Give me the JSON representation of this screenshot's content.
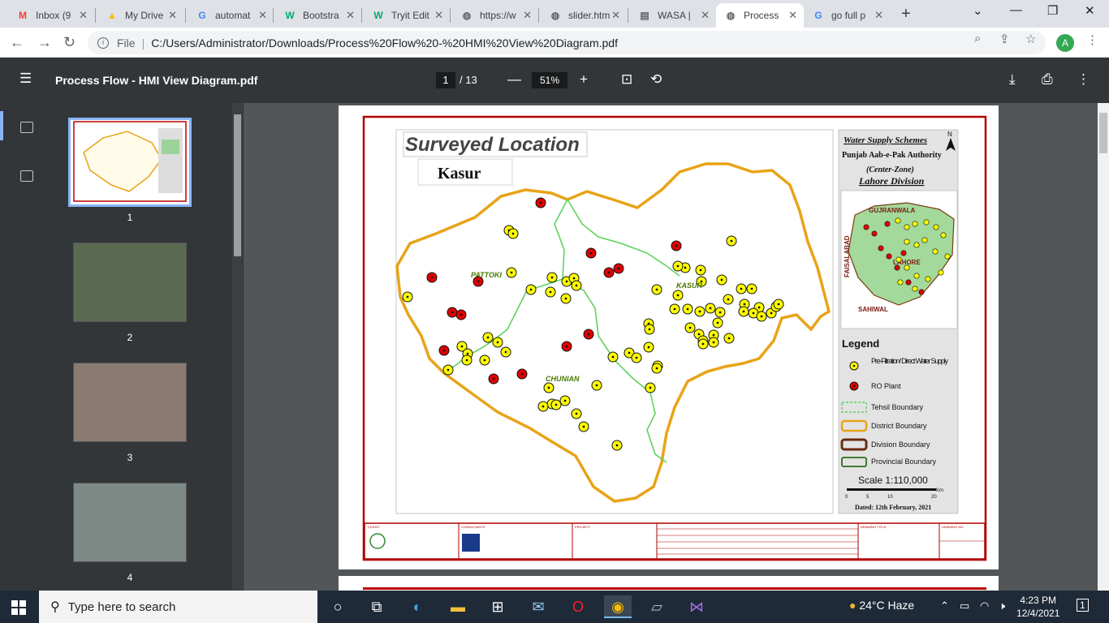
{
  "browser": {
    "tabs": [
      {
        "title": "Inbox (9",
        "icon": "gmail-icon",
        "glyph": "M",
        "color": "#ea4335"
      },
      {
        "title": "My Drive",
        "icon": "google-drive-icon",
        "glyph": "▲",
        "color": "#fbbc04"
      },
      {
        "title": "automat",
        "icon": "google-icon",
        "glyph": "G",
        "color": "#4285f4"
      },
      {
        "title": "Bootstra",
        "icon": "w3schools-icon",
        "glyph": "W",
        "color": "#04aa6d"
      },
      {
        "title": "Tryit Edit",
        "icon": "w3schools-icon",
        "glyph": "W",
        "color": "#04aa6d"
      },
      {
        "title": "https://w",
        "icon": "globe-icon",
        "glyph": "◍",
        "color": "#5f6368"
      },
      {
        "title": "slider.htm",
        "icon": "globe-icon",
        "glyph": "◍",
        "color": "#5f6368"
      },
      {
        "title": "WASA |",
        "icon": "document-icon",
        "glyph": "▤",
        "color": "#5f6368"
      },
      {
        "title": "Process",
        "icon": "globe-icon",
        "glyph": "◍",
        "color": "#5f6368",
        "active": true
      },
      {
        "title": "go full p",
        "icon": "google-icon",
        "glyph": "G",
        "color": "#4285f4"
      }
    ],
    "address": {
      "scheme_label": "File",
      "url": "C:/Users/Administrator/Downloads/Process%20Flow%20-%20HMI%20View%20Diagram.pdf"
    },
    "profile_initial": "A"
  },
  "pdf": {
    "title": "Process Flow - HMI View Diagram.pdf",
    "current_page": "1",
    "total_pages": "/ 13",
    "zoom": "51%",
    "thumbnails": [
      "1",
      "2",
      "3",
      "4"
    ]
  },
  "map": {
    "title": "Surveyed Location",
    "district": "Kasur",
    "towns": [
      "PATTOKI",
      "KASUR",
      "CHUNIAN"
    ],
    "header": {
      "line1": "Water Supply Schemes",
      "line2": "Punjab Aab-e-Pak Authority",
      "line3": "(Center-Zone)",
      "line4": "Lahore Division"
    },
    "inset_labels": [
      "GUJRANWALA",
      "FAISALABAD",
      "LAHORE",
      "SAHIWAL"
    ],
    "north": "N",
    "legend": {
      "title": "Legend",
      "pre_filtration": "Pre-Filtration/ Direct Water Supply",
      "ro_plant": "RO Plant",
      "tehsil": "Tehsil Boundary",
      "district": "District Boundary",
      "division": "Division Boundary",
      "provincial": "Provincial Boundary"
    },
    "scale": "Scale 1:110,000",
    "scale_ticks": [
      "0",
      "5",
      "10",
      "20"
    ],
    "scale_unit": "Km",
    "dated": "Dated: 12th February, 2021",
    "colors": {
      "frame": "#b00000",
      "district": "#e8a317",
      "tehsil": "#5ed35e",
      "ro": "#e00000",
      "prefilter": "#ffff00"
    },
    "title_block": {
      "client": "CLIENT:",
      "consultants": "CONSULTANTS:",
      "project": "PROJECT:",
      "drawing_title": "DRAWING TITLE:",
      "drawing_no": "DRAWING NO:"
    }
  },
  "taskbar": {
    "search_placeholder": "Type here to search",
    "weather": "24°C  Haze",
    "time": "4:23 PM",
    "date": "12/4/2021",
    "notifications": "1"
  }
}
